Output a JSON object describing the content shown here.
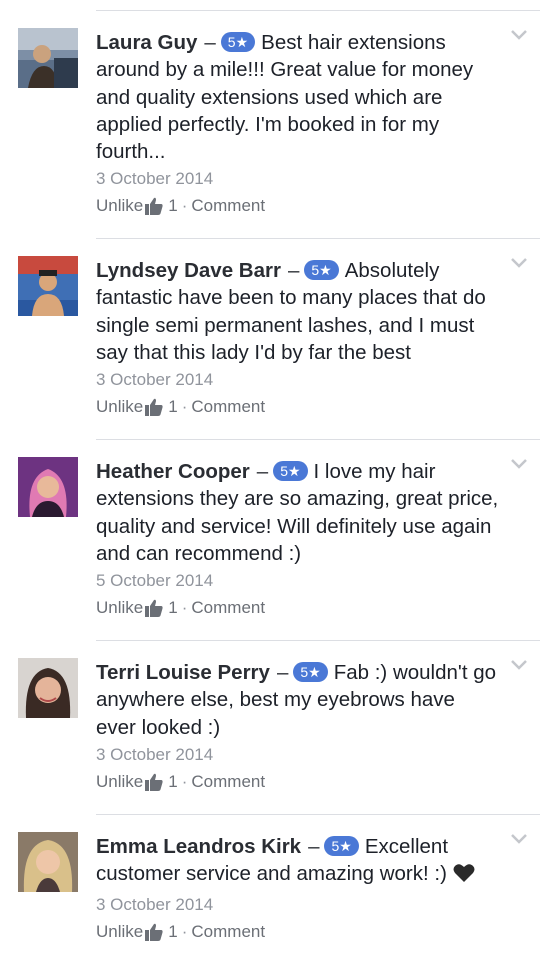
{
  "reviews": [
    {
      "name": "Laura Guy",
      "dash": "–",
      "rating": "5★",
      "text": "Best hair extensions around by a mile!!! Great value for money and quality extensions used which are applied perfectly. I'm booked in for my fourth...",
      "date": "3 October 2014",
      "unlike": "Unlike",
      "likes": "1",
      "comment": "Comment"
    },
    {
      "name": "Lyndsey Dave Barr",
      "dash": "–",
      "rating": "5★",
      "text": "Absolutely fantastic have been to many places that do single semi permanent lashes, and I must say that this lady I'd by far the best",
      "date": "3 October 2014",
      "unlike": "Unlike",
      "likes": "1",
      "comment": "Comment"
    },
    {
      "name": "Heather Cooper",
      "dash": "–",
      "rating": "5★",
      "text": "I love my hair extensions they are so amazing, great price, quality and service! Will definitely use again and can recommend :)",
      "date": "5 October 2014",
      "unlike": "Unlike",
      "likes": "1",
      "comment": "Comment"
    },
    {
      "name": "Terri Louise Perry",
      "dash": "–",
      "rating": "5★",
      "text": "Fab :) wouldn't go anywhere else, best my eyebrows have ever looked :)",
      "date": "3 October 2014",
      "unlike": "Unlike",
      "likes": "1",
      "comment": "Comment"
    },
    {
      "name": "Emma Leandros Kirk",
      "dash": "–",
      "rating": "5★",
      "text": "Excellent customer service and amazing work! :)",
      "date": "3 October 2014",
      "unlike": "Unlike",
      "likes": "1",
      "comment": "Comment"
    }
  ],
  "separator": "·",
  "colors": {
    "rating_badge": "#4a78d6",
    "meta_text": "#90949c",
    "divider": "#dcdee3"
  },
  "icons": {
    "like": "thumbs-up-icon",
    "more": "chevron-down-icon",
    "heart": "black-heart-icon"
  }
}
